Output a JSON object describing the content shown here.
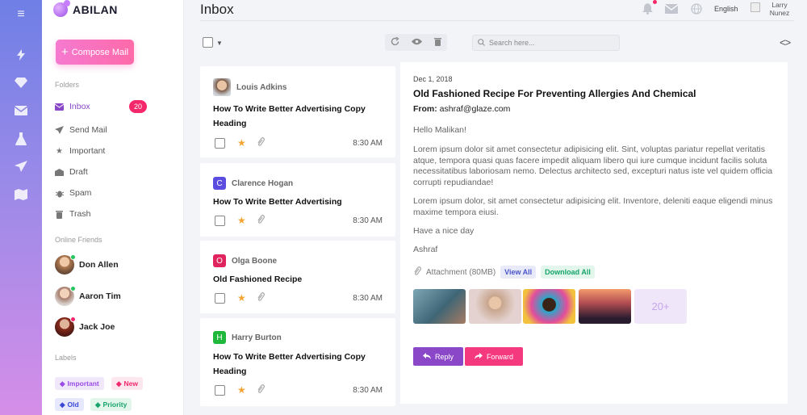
{
  "app": {
    "brand": "ABILAN",
    "page_title": "Inbox"
  },
  "header": {
    "language": "English",
    "user_name": "Larry Nunez"
  },
  "sidebar": {
    "compose_label": "Compose Mail",
    "folders_label": "Folders",
    "folders": [
      {
        "label": "Inbox",
        "icon": "mail-icon",
        "count": "20",
        "active": true
      },
      {
        "label": "Send Mail",
        "icon": "send-icon"
      },
      {
        "label": "Important",
        "icon": "star-icon"
      },
      {
        "label": "Draft",
        "icon": "draft-icon"
      },
      {
        "label": "Spam",
        "icon": "bug-icon"
      },
      {
        "label": "Trash",
        "icon": "trash-icon"
      }
    ],
    "friends_label": "Online Friends",
    "friends": [
      {
        "name": "Don Allen",
        "status_color": "#22c55e"
      },
      {
        "name": "Aaron Tim",
        "status_color": "#22c55e"
      },
      {
        "name": "Jack Joe",
        "status_color": "#f5276b"
      }
    ],
    "labels_label": "Labels",
    "labels": [
      {
        "label": "Important",
        "color": "#9a4de6",
        "bg": "#f1e7fb"
      },
      {
        "label": "New",
        "color": "#f5276b",
        "bg": "#fde7ef"
      },
      {
        "label": "Old",
        "color": "#3b48d6",
        "bg": "#e6e8fb"
      },
      {
        "label": "Priority",
        "color": "#16a46a",
        "bg": "#e2f6ec"
      }
    ]
  },
  "toolbar": {
    "search_placeholder": "Search here..."
  },
  "mails": [
    {
      "sender": "Louis Adkins",
      "initial": "",
      "avatar": "photo",
      "subject": "How To Write Better Advertising Copy Heading",
      "time": "8:30 AM"
    },
    {
      "sender": "Clarence Hogan",
      "initial": "C",
      "color": "#5b4de0",
      "subject": "How To Write Better Advertising",
      "time": "8:30 AM"
    },
    {
      "sender": "Olga Boone",
      "initial": "O",
      "color": "#e0245e",
      "subject": "Old Fashioned Recipe",
      "time": "8:30 AM"
    },
    {
      "sender": "Harry Burton",
      "initial": "H",
      "color": "#20b83a",
      "subject": "How To Write Better Advertising Copy Heading",
      "time": "8:30 AM"
    }
  ],
  "message": {
    "date": "Dec 1, 2018",
    "subject": "Old Fashioned Recipe For Preventing Allergies And Chemical",
    "from_label": "From:",
    "from": "ashraf@glaze.com",
    "greeting": "Hello Malikan!",
    "body1": "Lorem ipsum dolor sit amet consectetur adipisicing elit. Sint, voluptas pariatur repellat veritatis atque, tempora quasi quas facere impedit aliquam libero qui iure cumque incidunt facilis soluta necessitatibus laboriosam nemo. Delectus architecto sed, excepturi natus iste vel quidem officia corrupti repudiandae!",
    "body2": "Lorem ipsum dolor, sit amet consectetur adipisicing elit. Inventore, deleniti eaque eligendi minus maxime tempora eiusi.",
    "closing": "Have a nice day",
    "signature": "Ashraf",
    "attachment_label": "Attachment (80MB)",
    "view_all": "View All",
    "download_all": "Download All",
    "more_count": "20+",
    "reply": "Reply",
    "forward": "Forward"
  },
  "colors": {
    "accent": "#8a47c8",
    "pink": "#f5397e",
    "badge": "#f5276b"
  }
}
